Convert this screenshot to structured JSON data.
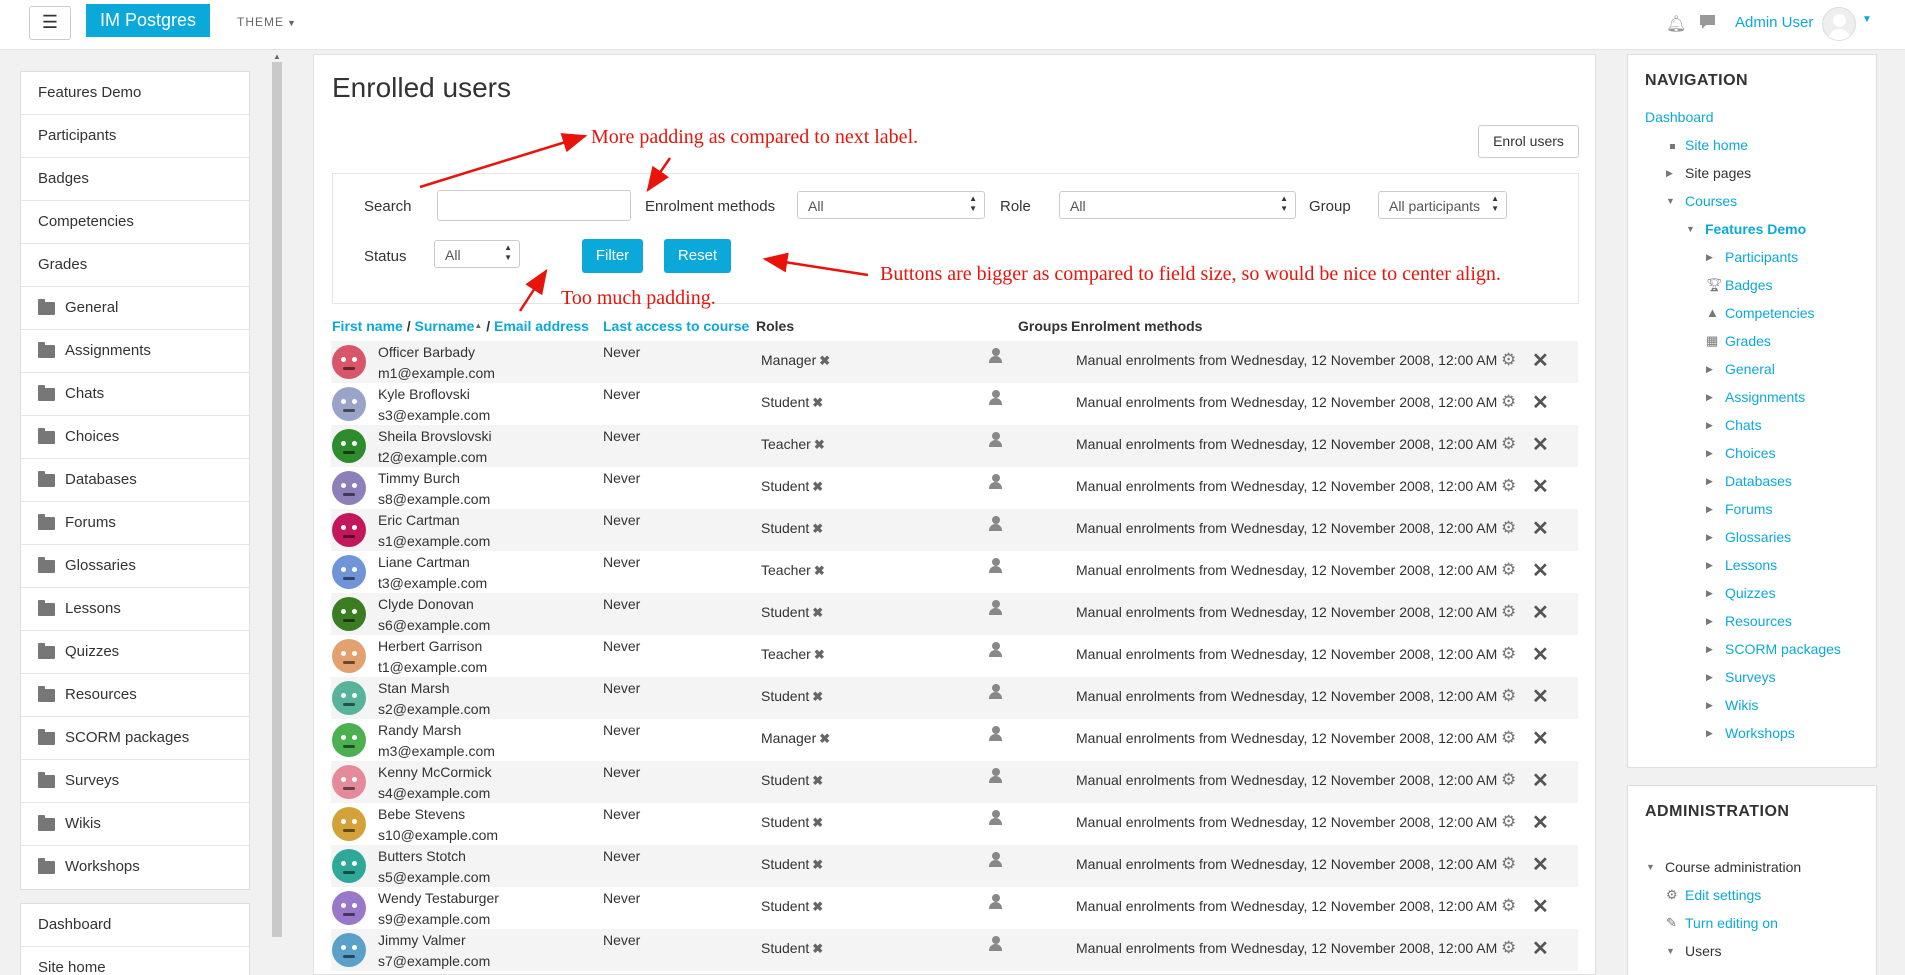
{
  "navbar": {
    "menu_icon": "☰",
    "brand": "IM Postgres",
    "theme_label": "THEME",
    "user_name": "Admin User"
  },
  "drawer": {
    "course_items": [
      {
        "label": "Features Demo",
        "folder": false
      },
      {
        "label": "Participants",
        "folder": false
      },
      {
        "label": "Badges",
        "folder": false
      },
      {
        "label": "Competencies",
        "folder": false
      },
      {
        "label": "Grades",
        "folder": false
      },
      {
        "label": "General",
        "folder": true
      },
      {
        "label": "Assignments",
        "folder": true
      },
      {
        "label": "Chats",
        "folder": true
      },
      {
        "label": "Choices",
        "folder": true
      },
      {
        "label": "Databases",
        "folder": true
      },
      {
        "label": "Forums",
        "folder": true
      },
      {
        "label": "Glossaries",
        "folder": true
      },
      {
        "label": "Lessons",
        "folder": true
      },
      {
        "label": "Quizzes",
        "folder": true
      },
      {
        "label": "Resources",
        "folder": true
      },
      {
        "label": "SCORM packages",
        "folder": true
      },
      {
        "label": "Surveys",
        "folder": true
      },
      {
        "label": "Wikis",
        "folder": true
      },
      {
        "label": "Workshops",
        "folder": true
      }
    ],
    "site_items": [
      "Dashboard",
      "Site home"
    ]
  },
  "main": {
    "title": "Enrolled users",
    "enrol_button": "Enrol users",
    "filter": {
      "search_label": "Search",
      "search_value": "",
      "enrolment_methods_label": "Enrolment methods",
      "enrolment_methods_value": "All",
      "role_label": "Role",
      "role_value": "All",
      "group_label": "Group",
      "group_value": "All participants",
      "status_label": "Status",
      "status_value": "All",
      "filter_button": "Filter",
      "reset_button": "Reset"
    },
    "annotations": {
      "padding_note": "More padding as compared to next label.",
      "buttons_note": "Buttons are bigger as compared to field size, so would be nice to center align.",
      "too_much_padding": "Too much padding."
    },
    "table": {
      "col_first_name": "First name",
      "sep1": " / ",
      "col_surname": "Surname",
      "sort_icon": "▲",
      "sep2": " / ",
      "col_email": "Email address",
      "col_last_access": "Last access to course",
      "col_roles": "Roles",
      "col_groups": "Groups",
      "col_enrolment": "Enrolment methods",
      "rows": [
        {
          "name": "Officer Barbady",
          "email": "m1@example.com",
          "last": "Never",
          "role": "Manager",
          "enrol": "Manual enrolments from Wednesday, 12 November 2008, 12:00 AM",
          "color": "#d9556a"
        },
        {
          "name": "Kyle Broflovski",
          "email": "s3@example.com",
          "last": "Never",
          "role": "Student",
          "enrol": "Manual enrolments from Wednesday, 12 November 2008, 12:00 AM",
          "color": "#9aa4c8"
        },
        {
          "name": "Sheila Brovslovski",
          "email": "t2@example.com",
          "last": "Never",
          "role": "Teacher",
          "enrol": "Manual enrolments from Wednesday, 12 November 2008, 12:00 AM",
          "color": "#2e8b2e"
        },
        {
          "name": "Timmy Burch",
          "email": "s8@example.com",
          "last": "Never",
          "role": "Student",
          "enrol": "Manual enrolments from Wednesday, 12 November 2008, 12:00 AM",
          "color": "#8d7fb7"
        },
        {
          "name": "Eric Cartman",
          "email": "s1@example.com",
          "last": "Never",
          "role": "Student",
          "enrol": "Manual enrolments from Wednesday, 12 November 2008, 12:00 AM",
          "color": "#c2185b"
        },
        {
          "name": "Liane Cartman",
          "email": "t3@example.com",
          "last": "Never",
          "role": "Teacher",
          "enrol": "Manual enrolments from Wednesday, 12 November 2008, 12:00 AM",
          "color": "#6f95d8"
        },
        {
          "name": "Clyde Donovan",
          "email": "s6@example.com",
          "last": "Never",
          "role": "Student",
          "enrol": "Manual enrolments from Wednesday, 12 November 2008, 12:00 AM",
          "color": "#3b7d23"
        },
        {
          "name": "Herbert Garrison",
          "email": "t1@example.com",
          "last": "Never",
          "role": "Teacher",
          "enrol": "Manual enrolments from Wednesday, 12 November 2008, 12:00 AM",
          "color": "#e3a170"
        },
        {
          "name": "Stan Marsh",
          "email": "s2@example.com",
          "last": "Never",
          "role": "Student",
          "enrol": "Manual enrolments from Wednesday, 12 November 2008, 12:00 AM",
          "color": "#58b39b"
        },
        {
          "name": "Randy Marsh",
          "email": "m3@example.com",
          "last": "Never",
          "role": "Manager",
          "enrol": "Manual enrolments from Wednesday, 12 November 2008, 12:00 AM",
          "color": "#4caf50"
        },
        {
          "name": "Kenny McCormick",
          "email": "s4@example.com",
          "last": "Never",
          "role": "Student",
          "enrol": "Manual enrolments from Wednesday, 12 November 2008, 12:00 AM",
          "color": "#e58a9a"
        },
        {
          "name": "Bebe Stevens",
          "email": "s10@example.com",
          "last": "Never",
          "role": "Student",
          "enrol": "Manual enrolments from Wednesday, 12 November 2008, 12:00 AM",
          "color": "#d4a23a"
        },
        {
          "name": "Butters Stotch",
          "email": "s5@example.com",
          "last": "Never",
          "role": "Student",
          "enrol": "Manual enrolments from Wednesday, 12 November 2008, 12:00 AM",
          "color": "#2fa89a"
        },
        {
          "name": "Wendy Testaburger",
          "email": "s9@example.com",
          "last": "Never",
          "role": "Student",
          "enrol": "Manual enrolments from Wednesday, 12 November 2008, 12:00 AM",
          "color": "#9a78c9"
        },
        {
          "name": "Jimmy Valmer",
          "email": "s7@example.com",
          "last": "Never",
          "role": "Student",
          "enrol": "Manual enrolments from Wednesday, 12 November 2008, 12:00 AM",
          "color": "#5aa0c8"
        }
      ]
    }
  },
  "navigation": {
    "title": "NAVIGATION",
    "items": [
      {
        "label": "Dashboard",
        "style": "link",
        "marker": "none",
        "indent": 0
      },
      {
        "label": "Site home",
        "style": "link",
        "marker": "square",
        "indent": 1
      },
      {
        "label": "Site pages",
        "style": "black",
        "marker": "right",
        "indent": 1
      },
      {
        "label": "Courses",
        "style": "link",
        "marker": "down",
        "indent": 1
      },
      {
        "label": "Features Demo",
        "style": "link-bold",
        "marker": "down",
        "indent": 2
      },
      {
        "label": "Participants",
        "style": "link",
        "marker": "right",
        "indent": 3
      },
      {
        "label": "Badges",
        "style": "link",
        "marker": "trophy",
        "indent": 3
      },
      {
        "label": "Competencies",
        "style": "link",
        "marker": "cone",
        "indent": 3
      },
      {
        "label": "Grades",
        "style": "link",
        "marker": "table",
        "indent": 3
      },
      {
        "label": "General",
        "style": "link",
        "marker": "right",
        "indent": 3
      },
      {
        "label": "Assignments",
        "style": "link",
        "marker": "right",
        "indent": 3
      },
      {
        "label": "Chats",
        "style": "link",
        "marker": "right",
        "indent": 3
      },
      {
        "label": "Choices",
        "style": "link",
        "marker": "right",
        "indent": 3
      },
      {
        "label": "Databases",
        "style": "link",
        "marker": "right",
        "indent": 3
      },
      {
        "label": "Forums",
        "style": "link",
        "marker": "right",
        "indent": 3
      },
      {
        "label": "Glossaries",
        "style": "link",
        "marker": "right",
        "indent": 3
      },
      {
        "label": "Lessons",
        "style": "link",
        "marker": "right",
        "indent": 3
      },
      {
        "label": "Quizzes",
        "style": "link",
        "marker": "right",
        "indent": 3
      },
      {
        "label": "Resources",
        "style": "link",
        "marker": "right",
        "indent": 3
      },
      {
        "label": "SCORM packages",
        "style": "link",
        "marker": "right",
        "indent": 3
      },
      {
        "label": "Surveys",
        "style": "link",
        "marker": "right",
        "indent": 3
      },
      {
        "label": "Wikis",
        "style": "link",
        "marker": "right",
        "indent": 3
      },
      {
        "label": "Workshops",
        "style": "link",
        "marker": "right",
        "indent": 3
      }
    ]
  },
  "administration": {
    "title": "ADMINISTRATION",
    "items": [
      {
        "label": "Course administration",
        "style": "black",
        "marker": "down",
        "indent": 0
      },
      {
        "label": "Edit settings",
        "style": "link",
        "marker": "gear",
        "indent": 1
      },
      {
        "label": "Turn editing on",
        "style": "link",
        "marker": "pencil",
        "indent": 1
      },
      {
        "label": "Users",
        "style": "black",
        "marker": "down",
        "indent": 1
      }
    ]
  },
  "colors": {
    "accent": "#0ba9d9",
    "annotation": "#e8140c"
  }
}
